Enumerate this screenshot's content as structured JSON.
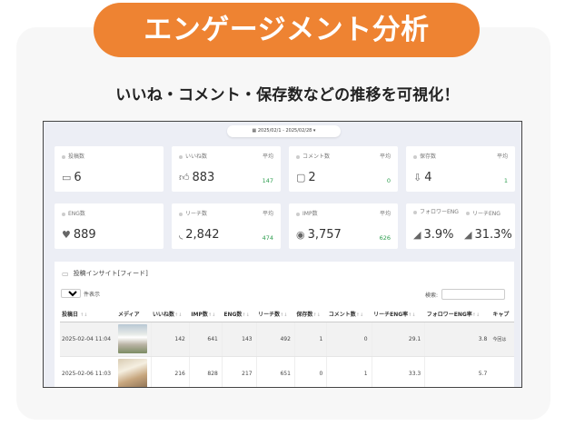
{
  "header": {
    "badge": "エンゲージメント分析",
    "subtitle": "いいね・コメント・保存数などの推移を可視化！"
  },
  "screen": {
    "date_range": "2025/02/1 - 2025/02/28",
    "stats_row1": [
      {
        "label": "投稿数",
        "value": "6",
        "icon": "laptop-icon",
        "avg_label": "",
        "avg": ""
      },
      {
        "label": "いいね数",
        "value": "883",
        "icon": "thumbs-up-icon",
        "avg_label": "平均",
        "avg": "147"
      },
      {
        "label": "コメント数",
        "value": "2",
        "icon": "comment-icon",
        "avg_label": "平均",
        "avg": "0"
      },
      {
        "label": "保存数",
        "value": "4",
        "icon": "save-icon",
        "avg_label": "平均",
        "avg": "1"
      }
    ],
    "stats_row2": [
      {
        "label": "ENG数",
        "value": "889",
        "icon": "heart-icon",
        "avg_label": "",
        "avg": ""
      },
      {
        "label": "リーチ数",
        "value": "2,842",
        "icon": "rss-icon",
        "avg_label": "平均",
        "avg": "474"
      },
      {
        "label": "IMP数",
        "value": "3,757",
        "icon": "eye-icon",
        "avg_label": "平均",
        "avg": "626"
      }
    ],
    "stat_dual": {
      "label1": "フォロワーENG",
      "value1": "3.9%",
      "icon1": "send-icon",
      "label2": "リーチENG",
      "value2": "31.3%",
      "icon2": "send-icon"
    },
    "panel": {
      "title": "投稿インサイト[フィード]",
      "length_value": "10",
      "length_suffix": "件表示",
      "search_label": "検索:",
      "columns": [
        "投稿日",
        "メディア",
        "いいね数",
        "IMP数",
        "ENG数",
        "リーチ数",
        "保存数",
        "コメント数",
        "リーチENG率",
        "フォロワーENG率",
        "キャプ"
      ],
      "rows": [
        {
          "date": "2025-02-04 11:04",
          "likes": "142",
          "imp": "641",
          "eng": "143",
          "reach": "492",
          "saves": "1",
          "comments": "0",
          "reach_eng": "29.1",
          "follower_eng": "3.8",
          "caption": "今回は"
        },
        {
          "date": "2025-02-06 11:03",
          "likes": "216",
          "imp": "828",
          "eng": "217",
          "reach": "651",
          "saves": "0",
          "comments": "1",
          "reach_eng": "33.3",
          "follower_eng": "5.7",
          "caption": ""
        }
      ]
    }
  }
}
